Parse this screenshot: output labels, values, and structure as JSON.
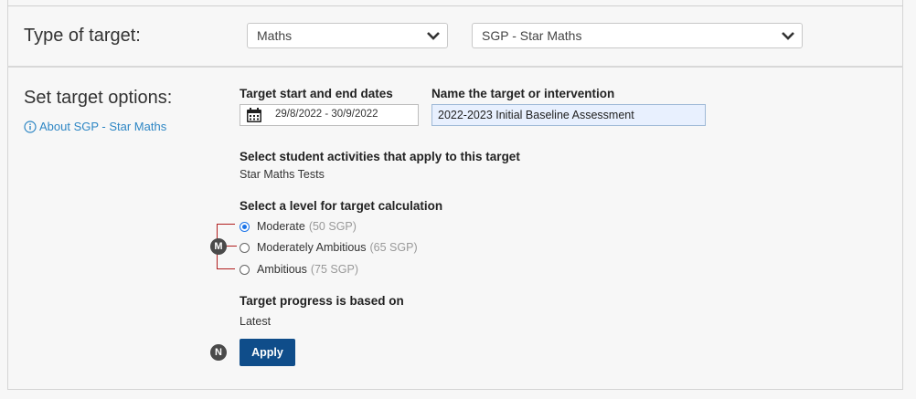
{
  "target_type": {
    "title": "Type of target:",
    "subject_select": "Maths",
    "assessment_select": "SGP - Star Maths"
  },
  "options": {
    "title": "Set target options:",
    "about_link": "About SGP - Star Maths",
    "dates_label": "Target start and end dates",
    "dates_value": "29/8/2022 - 30/9/2022",
    "name_label": "Name the target or intervention",
    "name_value": "2022-2023 Initial Baseline Assessment",
    "activities_label": "Select student activities that apply to this target",
    "activities_value": "Star Maths Tests",
    "level_label": "Select a level for target calculation",
    "levels": [
      {
        "label": "Moderate",
        "detail": "(50 SGP)",
        "checked": true
      },
      {
        "label": "Moderately Ambitious",
        "detail": "(65 SGP)",
        "checked": false
      },
      {
        "label": "Ambitious",
        "detail": "(75 SGP)",
        "checked": false
      }
    ],
    "progress_label": "Target progress is based on",
    "progress_value": "Latest",
    "apply_label": "Apply"
  },
  "annotations": {
    "m": "M",
    "n": "N",
    "bracket_color": "#b11e1e"
  },
  "colors": {
    "link": "#2d86c4",
    "primary_button": "#0f4d8a",
    "radio_selected": "#1a73e8",
    "input_highlight": "#e8f0fe"
  },
  "icons": {
    "chevron": "chevron-down-icon",
    "info": "info-circle-icon",
    "calendar": "calendar-icon"
  }
}
